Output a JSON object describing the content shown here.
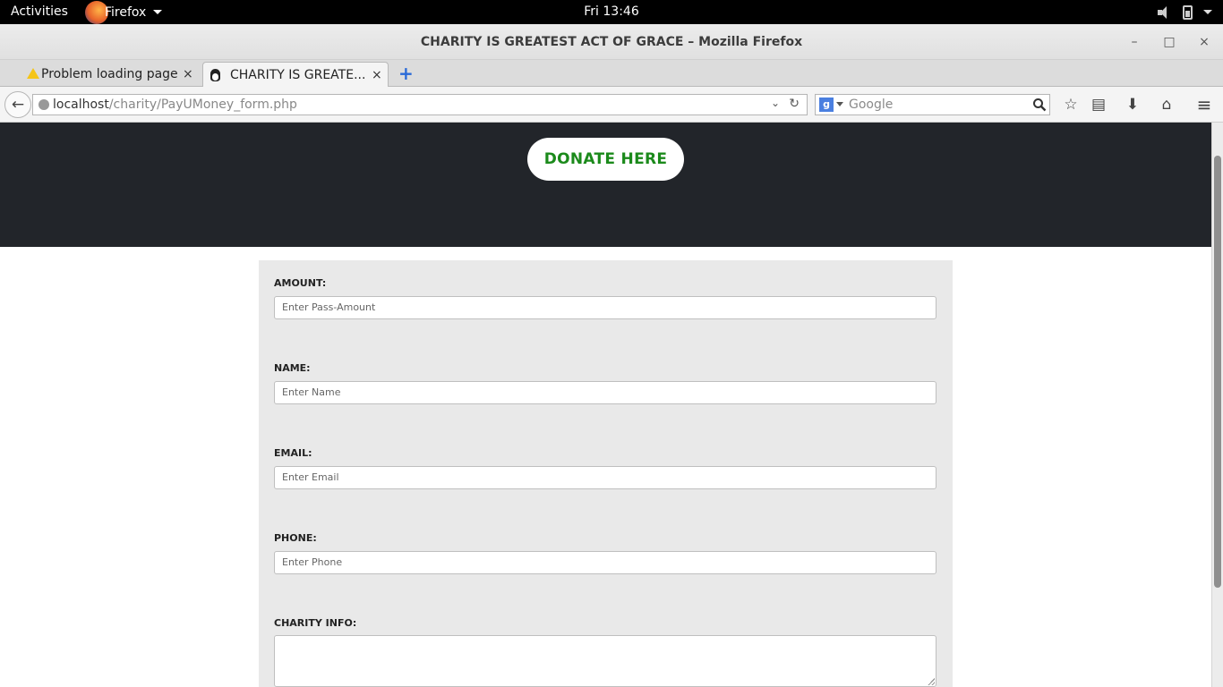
{
  "system_bar": {
    "activities": "Activities",
    "app_name": "Firefox",
    "clock": "Fri 13:46"
  },
  "window": {
    "title": "CHARITY IS GREATEST ACT OF GRACE – Mozilla Firefox",
    "minimize": "–",
    "maximize": "□",
    "close": "×"
  },
  "tabs": [
    {
      "label": "Problem loading page",
      "icon": "warning-icon",
      "close": "×"
    },
    {
      "label": "CHARITY IS GREATE...",
      "icon": "tux-icon",
      "close": "×"
    }
  ],
  "new_tab": "+",
  "navbar": {
    "back": "←",
    "url_host": "localhost",
    "url_path": "/charity/PayUMoney_form.php",
    "url_dropdown": "⌄",
    "reload": "↻",
    "search_engine": "g",
    "search_placeholder": "Google",
    "bookmark": "☆",
    "reading_list": "▤",
    "download": "⬇",
    "home": "⌂",
    "menu": "≡"
  },
  "page": {
    "donate_button": "DONATE HERE",
    "form": {
      "fields": [
        {
          "label": "AMOUNT:",
          "placeholder": "Enter Pass-Amount"
        },
        {
          "label": "NAME:",
          "placeholder": "Enter Name"
        },
        {
          "label": "EMAIL:",
          "placeholder": "Enter Email"
        },
        {
          "label": "PHONE:",
          "placeholder": "Enter Phone"
        }
      ],
      "charity_info_label": "CHARITY INFO:"
    }
  },
  "colors": {
    "hero_bg": "#22252a",
    "donate_text": "#1b8a1b",
    "form_bg": "#e9e9e9"
  }
}
